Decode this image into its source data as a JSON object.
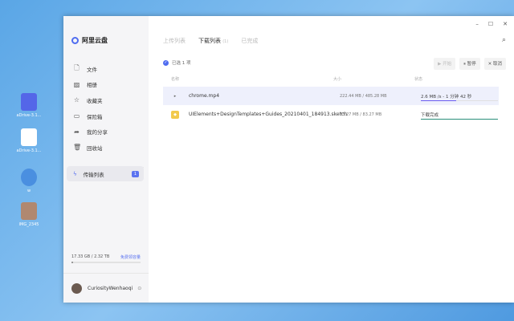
{
  "desktop": [
    {
      "label": "aDrive-3.1...",
      "color": "#5466e8"
    },
    {
      "label": "aDrive-3.1...",
      "color": "#ffffff"
    },
    {
      "label": "w",
      "color": "#4a8fe0"
    },
    {
      "label": "IMG_2345",
      "color": "#b08870"
    }
  ],
  "app": {
    "name": "阿里云盘",
    "accent": "#4f6cf0"
  },
  "window_controls": {
    "minimize": "–",
    "maximize": "☐",
    "close": "✕"
  },
  "sidebar": {
    "items": [
      {
        "label": "文件",
        "icon": "file-icon",
        "glyph": "🗋"
      },
      {
        "label": "相册",
        "icon": "photo-icon",
        "glyph": "▨"
      },
      {
        "label": "收藏夹",
        "icon": "star-icon",
        "glyph": "☆"
      },
      {
        "label": "保险箱",
        "icon": "safe-icon",
        "glyph": "▭"
      },
      {
        "label": "我的分享",
        "icon": "share-icon",
        "glyph": "➦"
      },
      {
        "label": "回收站",
        "icon": "trash-icon",
        "glyph": "🗑"
      }
    ],
    "transfer": {
      "label": "传输列表",
      "badge": "1"
    },
    "storage": {
      "text": "17.33 GB / 2.32 TB",
      "link": "免费领容量",
      "used_fraction": 0.007
    },
    "user": {
      "name": "CuriosityWenhaoqi"
    }
  },
  "tabs": [
    {
      "label": "上传列表"
    },
    {
      "label": "下载列表",
      "count": "(1)"
    },
    {
      "label": "已完成"
    }
  ],
  "selection": "已选 1 项",
  "actions": {
    "start": "▶ 开始",
    "pause": "⏸ 暂停",
    "cancel": "✕ 取消"
  },
  "columns": {
    "name": "名称",
    "size": "大小",
    "status": "状态"
  },
  "rows": [
    {
      "name": "chrome.mp4",
      "size": "222.44 MB / 485.28 MB",
      "status": "2.6 MB /s - 1 分钟 42 秒",
      "progress": 0.46,
      "bar_color": "#6b5cf0"
    },
    {
      "name": "UIElements+DesignTemplates+Guides_20210401_184913.sketch",
      "size": "83.27 MB / 83.27 MB",
      "status": "下载完成",
      "progress": 1,
      "bar_color": "#2a8f7a"
    }
  ]
}
